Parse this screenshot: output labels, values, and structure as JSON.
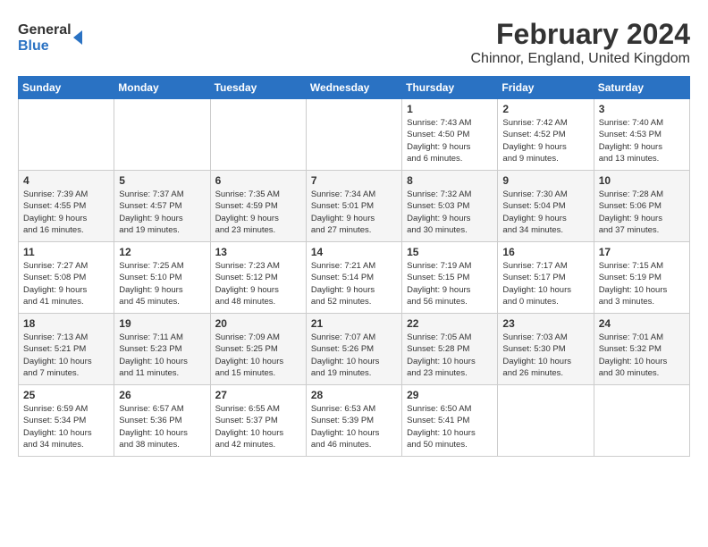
{
  "logo": {
    "line1": "General",
    "line2": "Blue"
  },
  "title": "February 2024",
  "subtitle": "Chinnor, England, United Kingdom",
  "days_of_week": [
    "Sunday",
    "Monday",
    "Tuesday",
    "Wednesday",
    "Thursday",
    "Friday",
    "Saturday"
  ],
  "weeks": [
    [
      {
        "day": "",
        "info": ""
      },
      {
        "day": "",
        "info": ""
      },
      {
        "day": "",
        "info": ""
      },
      {
        "day": "",
        "info": ""
      },
      {
        "day": "1",
        "info": "Sunrise: 7:43 AM\nSunset: 4:50 PM\nDaylight: 9 hours\nand 6 minutes."
      },
      {
        "day": "2",
        "info": "Sunrise: 7:42 AM\nSunset: 4:52 PM\nDaylight: 9 hours\nand 9 minutes."
      },
      {
        "day": "3",
        "info": "Sunrise: 7:40 AM\nSunset: 4:53 PM\nDaylight: 9 hours\nand 13 minutes."
      }
    ],
    [
      {
        "day": "4",
        "info": "Sunrise: 7:39 AM\nSunset: 4:55 PM\nDaylight: 9 hours\nand 16 minutes."
      },
      {
        "day": "5",
        "info": "Sunrise: 7:37 AM\nSunset: 4:57 PM\nDaylight: 9 hours\nand 19 minutes."
      },
      {
        "day": "6",
        "info": "Sunrise: 7:35 AM\nSunset: 4:59 PM\nDaylight: 9 hours\nand 23 minutes."
      },
      {
        "day": "7",
        "info": "Sunrise: 7:34 AM\nSunset: 5:01 PM\nDaylight: 9 hours\nand 27 minutes."
      },
      {
        "day": "8",
        "info": "Sunrise: 7:32 AM\nSunset: 5:03 PM\nDaylight: 9 hours\nand 30 minutes."
      },
      {
        "day": "9",
        "info": "Sunrise: 7:30 AM\nSunset: 5:04 PM\nDaylight: 9 hours\nand 34 minutes."
      },
      {
        "day": "10",
        "info": "Sunrise: 7:28 AM\nSunset: 5:06 PM\nDaylight: 9 hours\nand 37 minutes."
      }
    ],
    [
      {
        "day": "11",
        "info": "Sunrise: 7:27 AM\nSunset: 5:08 PM\nDaylight: 9 hours\nand 41 minutes."
      },
      {
        "day": "12",
        "info": "Sunrise: 7:25 AM\nSunset: 5:10 PM\nDaylight: 9 hours\nand 45 minutes."
      },
      {
        "day": "13",
        "info": "Sunrise: 7:23 AM\nSunset: 5:12 PM\nDaylight: 9 hours\nand 48 minutes."
      },
      {
        "day": "14",
        "info": "Sunrise: 7:21 AM\nSunset: 5:14 PM\nDaylight: 9 hours\nand 52 minutes."
      },
      {
        "day": "15",
        "info": "Sunrise: 7:19 AM\nSunset: 5:15 PM\nDaylight: 9 hours\nand 56 minutes."
      },
      {
        "day": "16",
        "info": "Sunrise: 7:17 AM\nSunset: 5:17 PM\nDaylight: 10 hours\nand 0 minutes."
      },
      {
        "day": "17",
        "info": "Sunrise: 7:15 AM\nSunset: 5:19 PM\nDaylight: 10 hours\nand 3 minutes."
      }
    ],
    [
      {
        "day": "18",
        "info": "Sunrise: 7:13 AM\nSunset: 5:21 PM\nDaylight: 10 hours\nand 7 minutes."
      },
      {
        "day": "19",
        "info": "Sunrise: 7:11 AM\nSunset: 5:23 PM\nDaylight: 10 hours\nand 11 minutes."
      },
      {
        "day": "20",
        "info": "Sunrise: 7:09 AM\nSunset: 5:25 PM\nDaylight: 10 hours\nand 15 minutes."
      },
      {
        "day": "21",
        "info": "Sunrise: 7:07 AM\nSunset: 5:26 PM\nDaylight: 10 hours\nand 19 minutes."
      },
      {
        "day": "22",
        "info": "Sunrise: 7:05 AM\nSunset: 5:28 PM\nDaylight: 10 hours\nand 23 minutes."
      },
      {
        "day": "23",
        "info": "Sunrise: 7:03 AM\nSunset: 5:30 PM\nDaylight: 10 hours\nand 26 minutes."
      },
      {
        "day": "24",
        "info": "Sunrise: 7:01 AM\nSunset: 5:32 PM\nDaylight: 10 hours\nand 30 minutes."
      }
    ],
    [
      {
        "day": "25",
        "info": "Sunrise: 6:59 AM\nSunset: 5:34 PM\nDaylight: 10 hours\nand 34 minutes."
      },
      {
        "day": "26",
        "info": "Sunrise: 6:57 AM\nSunset: 5:36 PM\nDaylight: 10 hours\nand 38 minutes."
      },
      {
        "day": "27",
        "info": "Sunrise: 6:55 AM\nSunset: 5:37 PM\nDaylight: 10 hours\nand 42 minutes."
      },
      {
        "day": "28",
        "info": "Sunrise: 6:53 AM\nSunset: 5:39 PM\nDaylight: 10 hours\nand 46 minutes."
      },
      {
        "day": "29",
        "info": "Sunrise: 6:50 AM\nSunset: 5:41 PM\nDaylight: 10 hours\nand 50 minutes."
      },
      {
        "day": "",
        "info": ""
      },
      {
        "day": "",
        "info": ""
      }
    ]
  ]
}
